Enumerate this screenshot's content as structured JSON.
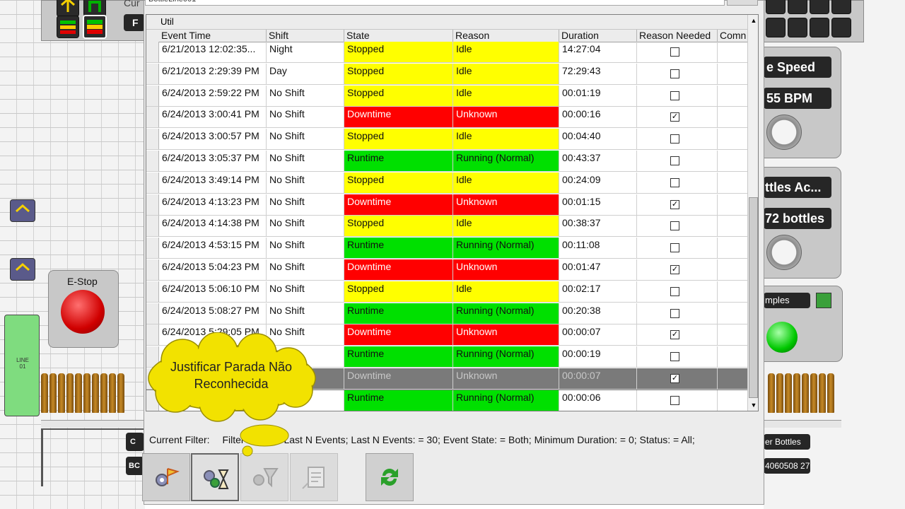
{
  "window": {
    "title_fragment": "BottleLine001"
  },
  "hmi": {
    "top_left_label": "Cur",
    "top_left_field": "F",
    "estop_label": "E-Stop",
    "line_label": "LINE\n01",
    "speed_title": "e Speed",
    "speed_value": "55 BPM",
    "bottles_title": "ttles Ac...",
    "bottles_value": "72 bottles",
    "samples_label": "mples",
    "bottles_small": "er Bottles",
    "bottles_number": "4060508 27",
    "bottom_left_1": "C",
    "bottom_left_2": "BC"
  },
  "grid": {
    "group_label": "Util",
    "columns": [
      "Event Time",
      "Shift",
      "State",
      "Reason",
      "Duration",
      "Reason Needed",
      "Comn"
    ],
    "rows": [
      {
        "time": "6/21/2013  12:02:35...",
        "shift": "Night",
        "state": "Stopped",
        "reason": "Idle",
        "duration": "14:27:04",
        "needed": false,
        "color": "#ffff00"
      },
      {
        "time": "6/21/2013 2:29:39 PM",
        "shift": "Day",
        "state": "Stopped",
        "reason": "Idle",
        "duration": "72:29:43",
        "needed": false,
        "color": "#ffff00"
      },
      {
        "time": "6/24/2013 2:59:22 PM",
        "shift": "No Shift",
        "state": "Stopped",
        "reason": "Idle",
        "duration": "00:01:19",
        "needed": false,
        "color": "#ffff00"
      },
      {
        "time": "6/24/2013 3:00:41 PM",
        "shift": "No Shift",
        "state": "Downtime",
        "reason": "Unknown",
        "duration": "00:00:16",
        "needed": true,
        "color": "#ff0000"
      },
      {
        "time": "6/24/2013 3:00:57 PM",
        "shift": "No Shift",
        "state": "Stopped",
        "reason": "Idle",
        "duration": "00:04:40",
        "needed": false,
        "color": "#ffff00"
      },
      {
        "time": "6/24/2013 3:05:37 PM",
        "shift": "No Shift",
        "state": "Runtime",
        "reason": "Running (Normal)",
        "duration": "00:43:37",
        "needed": false,
        "color": "#00e000"
      },
      {
        "time": "6/24/2013 3:49:14 PM",
        "shift": "No Shift",
        "state": "Stopped",
        "reason": "Idle",
        "duration": "00:24:09",
        "needed": false,
        "color": "#ffff00"
      },
      {
        "time": "6/24/2013 4:13:23 PM",
        "shift": "No Shift",
        "state": "Downtime",
        "reason": "Unknown",
        "duration": "00:01:15",
        "needed": true,
        "color": "#ff0000"
      },
      {
        "time": "6/24/2013 4:14:38 PM",
        "shift": "No Shift",
        "state": "Stopped",
        "reason": "Idle",
        "duration": "00:38:37",
        "needed": false,
        "color": "#ffff00"
      },
      {
        "time": "6/24/2013 4:53:15 PM",
        "shift": "No Shift",
        "state": "Runtime",
        "reason": "Running (Normal)",
        "duration": "00:11:08",
        "needed": false,
        "color": "#00e000"
      },
      {
        "time": "6/24/2013 5:04:23 PM",
        "shift": "No Shift",
        "state": "Downtime",
        "reason": "Unknown",
        "duration": "00:01:47",
        "needed": true,
        "color": "#ff0000"
      },
      {
        "time": "6/24/2013 5:06:10 PM",
        "shift": "No Shift",
        "state": "Stopped",
        "reason": "Idle",
        "duration": "00:02:17",
        "needed": false,
        "color": "#ffff00"
      },
      {
        "time": "6/24/2013 5:08:27 PM",
        "shift": "No Shift",
        "state": "Runtime",
        "reason": "Running (Normal)",
        "duration": "00:20:38",
        "needed": false,
        "color": "#00e000"
      },
      {
        "time": "6/24/2013 5:29:05 PM",
        "shift": "No Shift",
        "state": "Downtime",
        "reason": "Unknown",
        "duration": "00:00:07",
        "needed": true,
        "color": "#ff0000"
      },
      {
        "time": "",
        "shift": "",
        "state": "Runtime",
        "reason": "Running (Normal)",
        "duration": "00:00:19",
        "needed": false,
        "color": "#00e000"
      },
      {
        "time": "",
        "shift": "",
        "state": "Downtime",
        "reason": "Unknown",
        "duration": "00:00:07",
        "needed": true,
        "color": "#ff0000",
        "selected": true
      },
      {
        "time": "",
        "shift": "",
        "state": "Runtime",
        "reason": "Running (Normal)",
        "duration": "00:00:06",
        "needed": false,
        "color": "#00e000"
      }
    ]
  },
  "filter": {
    "label": "Current Filter:",
    "text_prefix": "Filter",
    "text_rest": "Last N Events; Last N Events: = 30; Event State: = Both; Minimum Duration: = 0; Status: = All;"
  },
  "callout": {
    "text": "Justificar Parada Não Reconhecida"
  },
  "toolbar": {
    "buttons": [
      {
        "icon": "settings-flag-icon"
      },
      {
        "icon": "settings-hourglass-icon"
      },
      {
        "icon": "settings-filter-icon"
      },
      {
        "icon": "notepad-icon"
      },
      {
        "icon": "refresh-icon"
      }
    ]
  }
}
